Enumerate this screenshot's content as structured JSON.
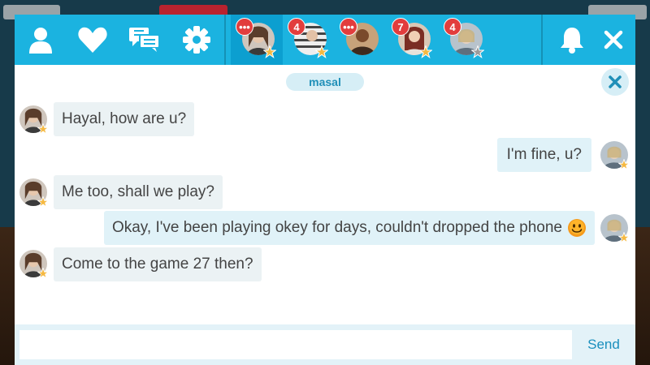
{
  "colors": {
    "topbar": "#1bb3e0",
    "topbar_active": "#0c9fd0",
    "badge": "#e23d3d",
    "accent_text": "#1f8fb8",
    "bubble_other": "#ebf2f4",
    "bubble_mine": "#e0f2f8",
    "star": "#f5b942"
  },
  "nav": {
    "icons": [
      "person-icon",
      "heart-icon",
      "chat-bubbles-icon",
      "gear-icon"
    ],
    "right_icons": [
      "bell-icon",
      "close-icon"
    ]
  },
  "conversations": [
    {
      "badge": "•••",
      "active": true,
      "star": "gold"
    },
    {
      "badge": "4",
      "active": false,
      "star": "gold"
    },
    {
      "badge": "•••",
      "active": false,
      "star": "none"
    },
    {
      "badge": "7",
      "active": false,
      "star": "gold"
    },
    {
      "badge": "4",
      "active": false,
      "star": "grey"
    }
  ],
  "chat": {
    "partner_name": "masal",
    "messages": [
      {
        "from": "them",
        "text": "Hayal, how are u?"
      },
      {
        "from": "me",
        "text": "I'm fine, u?"
      },
      {
        "from": "them",
        "text": "Me too, shall we play?"
      },
      {
        "from": "me",
        "text": "Okay, I've been playing okey for days, couldn't dropped the phone",
        "emoji": "smiley-emoji"
      },
      {
        "from": "them",
        "text": "Come to the game 27 then?"
      }
    ]
  },
  "composer": {
    "placeholder": "",
    "value": "",
    "send_label": "Send"
  }
}
